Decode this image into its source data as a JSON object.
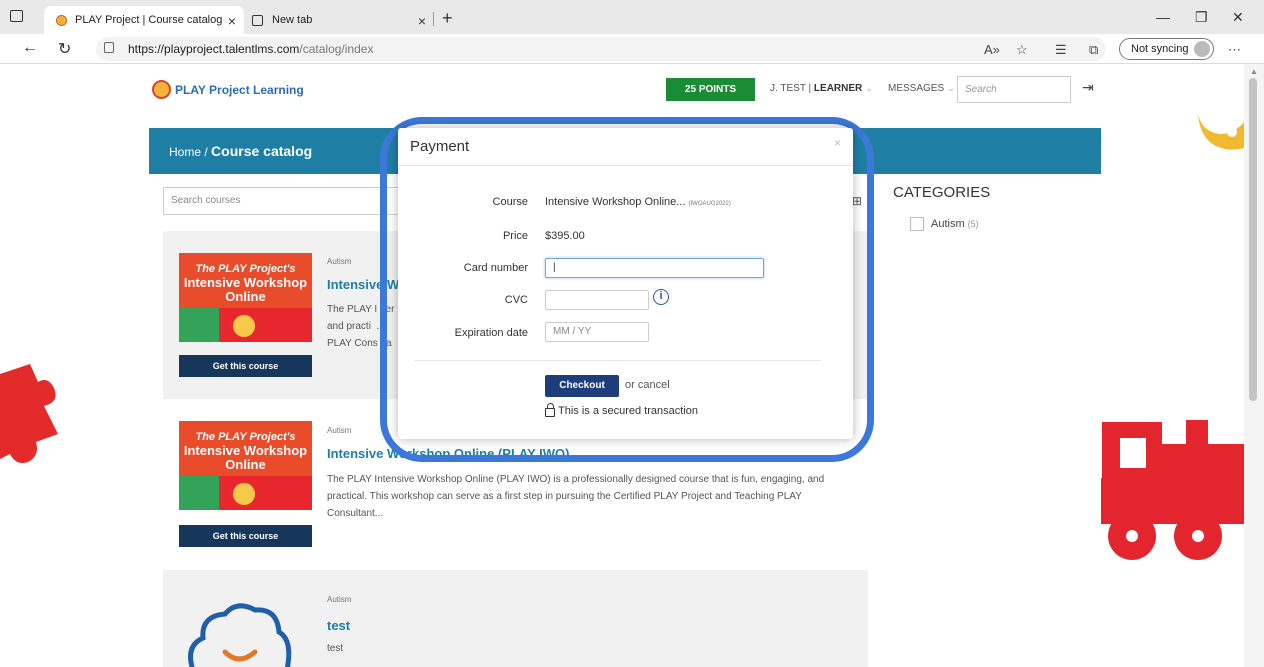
{
  "browser": {
    "tabs": [
      {
        "title": "PLAY Project | Course catalog",
        "active": true
      },
      {
        "title": "New tab",
        "active": false
      }
    ],
    "url_host": "https://playproject.talentlms.com",
    "url_path": "/catalog/index",
    "sync_label": "Not syncing"
  },
  "site": {
    "logo_text": "PLAY Project Learning",
    "points": "25 POINTS",
    "user_name": "J. TEST",
    "user_role": "LEARNER",
    "messages": "MESSAGES",
    "search_placeholder": "Search"
  },
  "catalog": {
    "breadcrumb_home": "Home /",
    "breadcrumb_current": "Course catalog",
    "search_placeholder": "Search courses",
    "categories_title": "CATEGORIES",
    "categories": [
      {
        "label": "Autism",
        "count": "(5)"
      }
    ],
    "courses": [
      {
        "category": "Autism",
        "title": "Intensive W",
        "description": "The PLAY I  ter\nand practi  . \nPLAY Cons  ta",
        "button": "Get this course",
        "thumb_line1": "The PLAY Project's",
        "thumb_line2": "Intensive Workshop Online"
      },
      {
        "category": "Autism",
        "title": "Intensive Workshop Online (PLAY IWO)",
        "description": "The PLAY Intensive Workshop Online (PLAY IWO) is a professionally designed course that is fun, engaging, and practical. This workshop can serve as a first step in pursuing the Certified PLAY Project and Teaching PLAY Consultant...",
        "button": "Get this course",
        "thumb_line1": "The PLAY Project's",
        "thumb_line2": "Intensive Workshop Online"
      },
      {
        "category": "Autism",
        "title": "test",
        "description": "test"
      }
    ]
  },
  "payment": {
    "title": "Payment",
    "close": "×",
    "course_label": "Course",
    "course_value": "Intensive Workshop Online...",
    "course_code": "(IWOAUG2022)",
    "price_label": "Price",
    "price_value": "$395.00",
    "card_label": "Card number",
    "card_value": "|",
    "cvc_label": "CVC",
    "cvc_value": "",
    "exp_label": "Expiration date",
    "exp_placeholder": "MM / YY",
    "checkout_label": "Checkout",
    "cancel_text": "or cancel",
    "secured_text": "This is a secured transaction"
  },
  "colors": {
    "header_blue": "#1f7ea4",
    "points_green": "#1b8c36",
    "checkout_navy": "#1f3d7a",
    "highlight_blue": "#3b78d7"
  }
}
